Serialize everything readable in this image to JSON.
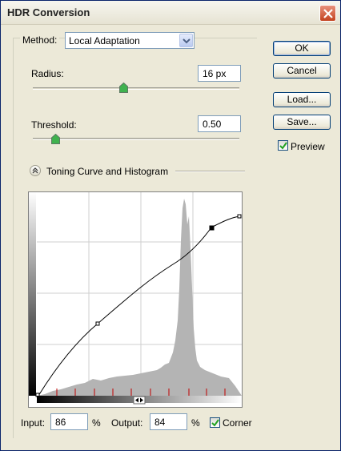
{
  "window": {
    "title": "HDR Conversion"
  },
  "method": {
    "label": "Method:",
    "value": "Local Adaptation"
  },
  "radius": {
    "label": "Radius:",
    "value": "16 px",
    "slider_fraction": 0.44
  },
  "threshold": {
    "label": "Threshold:",
    "value": "0.50",
    "slider_fraction": 0.11
  },
  "toning": {
    "label": "Toning Curve and Histogram"
  },
  "buttons": {
    "ok": "OK",
    "cancel": "Cancel",
    "load": "Load...",
    "save": "Save..."
  },
  "preview": {
    "label": "Preview",
    "checked": true
  },
  "curve": {
    "input_label": "Input:",
    "input_value": "86",
    "input_unit": "%",
    "output_label": "Output:",
    "output_value": "84",
    "output_unit": "%",
    "corner_label": "Corner",
    "corner_checked": true
  },
  "icons": {
    "close": "close-icon",
    "dropdown": "chevron-down-icon",
    "collapse": "double-chevron-up-icon",
    "check": "checkmark-icon",
    "slider_thumb": "slider-thumb-icon",
    "gradient_arrows": "left-right-arrows-icon"
  },
  "colors": {
    "title_bar": "#ece9d8",
    "close": "#d9512c",
    "accent": "#003c74",
    "histogram": "#b4b4b4"
  }
}
